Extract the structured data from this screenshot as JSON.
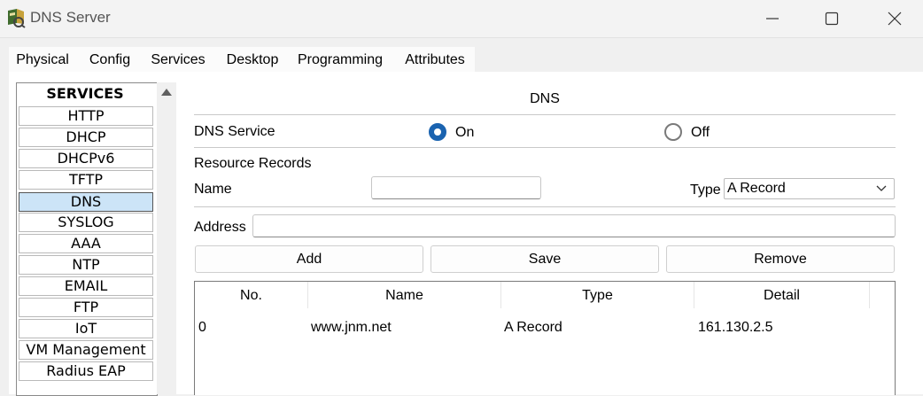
{
  "window": {
    "title": "DNS Server",
    "icon": "packet-tracer-server-icon",
    "controls": [
      "minimize-icon",
      "maximize-icon",
      "close-icon"
    ]
  },
  "tabs": [
    {
      "label": "Physical",
      "active": false
    },
    {
      "label": "Config",
      "active": false
    },
    {
      "label": "Services",
      "active": true
    },
    {
      "label": "Desktop",
      "active": false
    },
    {
      "label": "Programming",
      "active": false
    },
    {
      "label": "Attributes",
      "active": false
    }
  ],
  "services": {
    "header": "SERVICES",
    "items": [
      "HTTP",
      "DHCP",
      "DHCPv6",
      "TFTP",
      "DNS",
      "SYSLOG",
      "AAA",
      "NTP",
      "EMAIL",
      "FTP",
      "IoT",
      "VM Management",
      "Radius EAP"
    ],
    "selected": "DNS"
  },
  "dns": {
    "title": "DNS",
    "service_label": "DNS Service",
    "on_label": "On",
    "off_label": "Off",
    "service_state": "On",
    "records_label": "Resource Records",
    "name_label": "Name",
    "name_value": "",
    "type_label": "Type",
    "type_value": "A Record",
    "address_label": "Address",
    "address_value": "",
    "buttons": {
      "add": "Add",
      "save": "Save",
      "remove": "Remove"
    },
    "table": {
      "columns": [
        "No.",
        "Name",
        "Type",
        "Detail"
      ],
      "rows": [
        {
          "no": "0",
          "name": "www.jnm.net",
          "type": "A Record",
          "detail": "161.130.2.5"
        }
      ]
    }
  },
  "colors": {
    "selected_service_bg": "#cce4f7",
    "radio_on": "#1a63b0",
    "tab_underline": "#1f3a56"
  }
}
